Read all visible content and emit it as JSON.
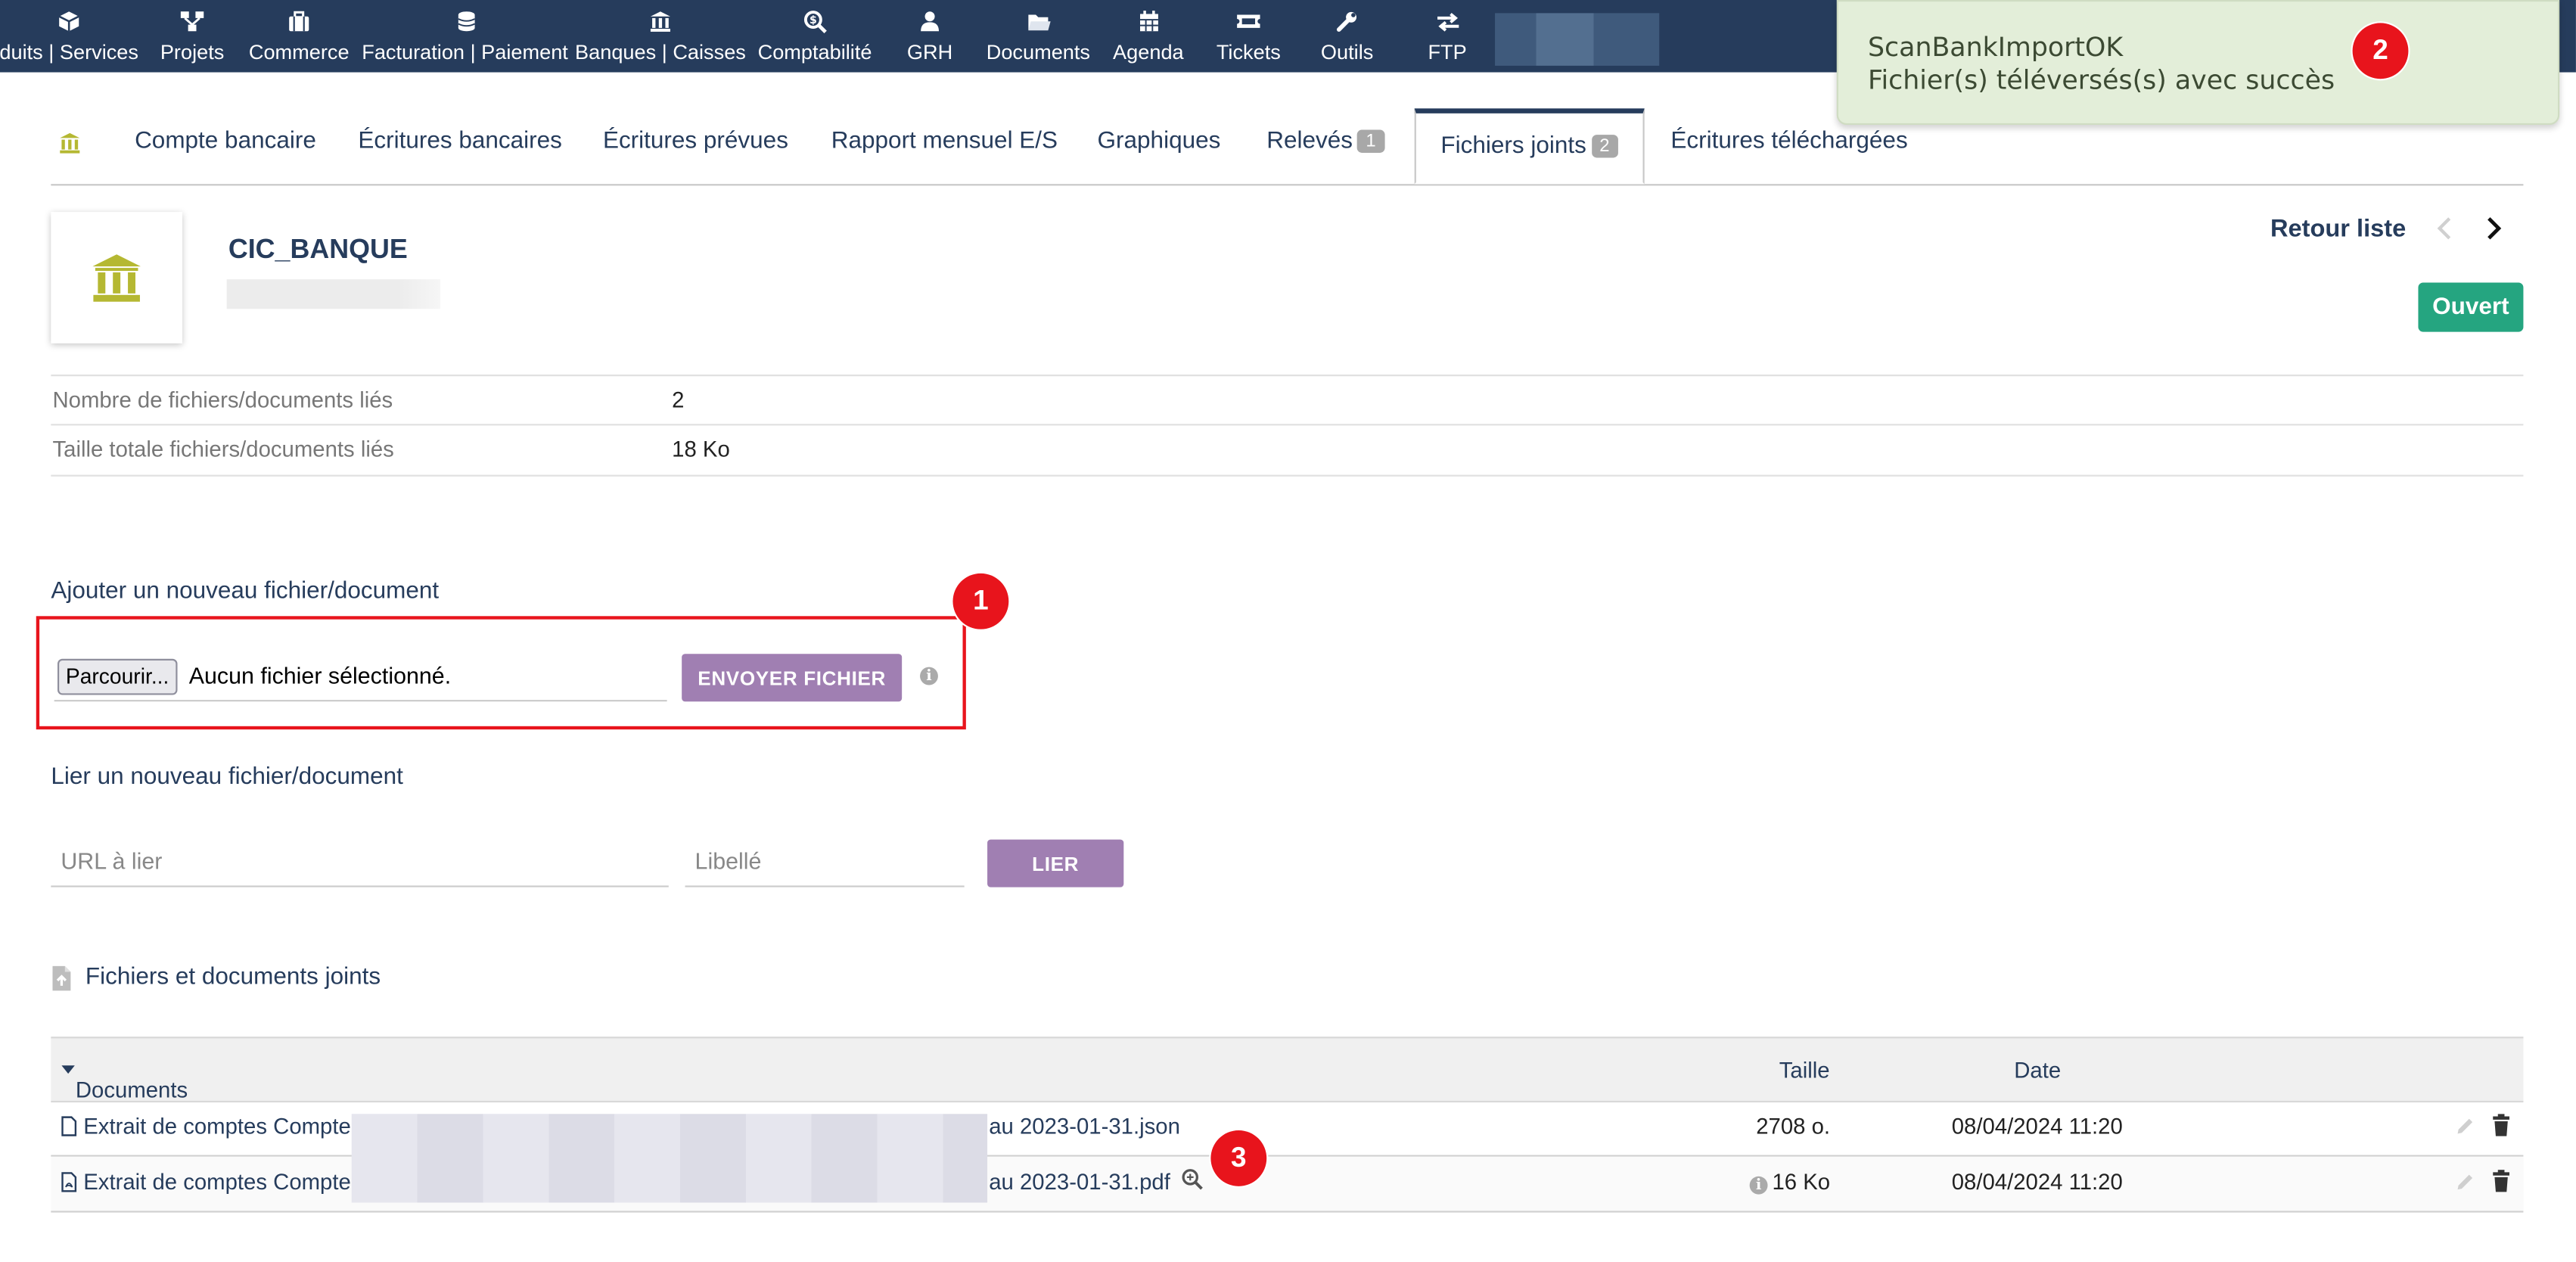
{
  "topnav": {
    "items": [
      {
        "label": "duits | Services",
        "icon": "cube-icon"
      },
      {
        "label": "Projets",
        "icon": "project-icon"
      },
      {
        "label": "Commerce",
        "icon": "briefcase-icon"
      },
      {
        "label": "Facturation | Paiement",
        "icon": "coins-icon"
      },
      {
        "label": "Banques | Caisses",
        "icon": "bank-icon"
      },
      {
        "label": "Comptabilité",
        "icon": "search-dollar-icon"
      },
      {
        "label": "GRH",
        "icon": "user-icon"
      },
      {
        "label": "Documents",
        "icon": "folder-icon"
      },
      {
        "label": "Agenda",
        "icon": "calendar-icon"
      },
      {
        "label": "Tickets",
        "icon": "ticket-icon"
      },
      {
        "label": "Outils",
        "icon": "wrench-icon"
      },
      {
        "label": "FTP",
        "icon": "exchange-icon"
      }
    ],
    "bar_color": "#263c5c"
  },
  "notification": {
    "line1": "ScanBankImportOK",
    "line2": "Fichier(s) téléversés(s) avec succès",
    "bg_color": "#e3eed9"
  },
  "markers": [
    "1",
    "2",
    "3"
  ],
  "tabs": [
    {
      "label": "Compte bancaire"
    },
    {
      "label": "Écritures bancaires"
    },
    {
      "label": "Écritures prévues"
    },
    {
      "label": "Rapport mensuel E/S"
    },
    {
      "label": "Graphiques"
    },
    {
      "label": "Relevés",
      "badge": "1"
    },
    {
      "label": "Fichiers joints",
      "badge": "2",
      "active": true
    },
    {
      "label": "Écritures téléchargées"
    }
  ],
  "account": {
    "name": "CIC_BANQUE",
    "back_label": "Retour liste",
    "status": "Ouvert",
    "status_color": "#25a580",
    "logo_color": "#b5b832"
  },
  "stats": [
    {
      "label": "Nombre de fichiers/documents liés",
      "value": "2"
    },
    {
      "label": "Taille totale fichiers/documents liés",
      "value": "18 Ko"
    }
  ],
  "upload": {
    "title": "Ajouter un nouveau fichier/document",
    "browse_label": "Parcourir...",
    "file_status": "Aucun fichier sélectionné.",
    "send_label": "ENVOYER FICHIER",
    "button_color": "#a07fb2"
  },
  "link": {
    "title": "Lier un nouveau fichier/document",
    "url_placeholder": "URL à lier",
    "label_placeholder": "Libellé",
    "button_label": "LIER"
  },
  "files": {
    "title": "Fichiers et documents joints",
    "columns": {
      "name": "Documents",
      "size": "Taille",
      "date": "Date"
    },
    "rows": [
      {
        "name_start": "Extrait de comptes Compte",
        "name_end": "au 2023-01-31.json",
        "size": "2708 o.",
        "date": "08/04/2024 11:20",
        "icon": "file-icon"
      },
      {
        "name_start": "Extrait de comptes Compte",
        "name_end": "au 2023-01-31.pdf",
        "size": "16 Ko",
        "date": "08/04/2024 11:20",
        "icon": "pdf-icon"
      }
    ]
  }
}
